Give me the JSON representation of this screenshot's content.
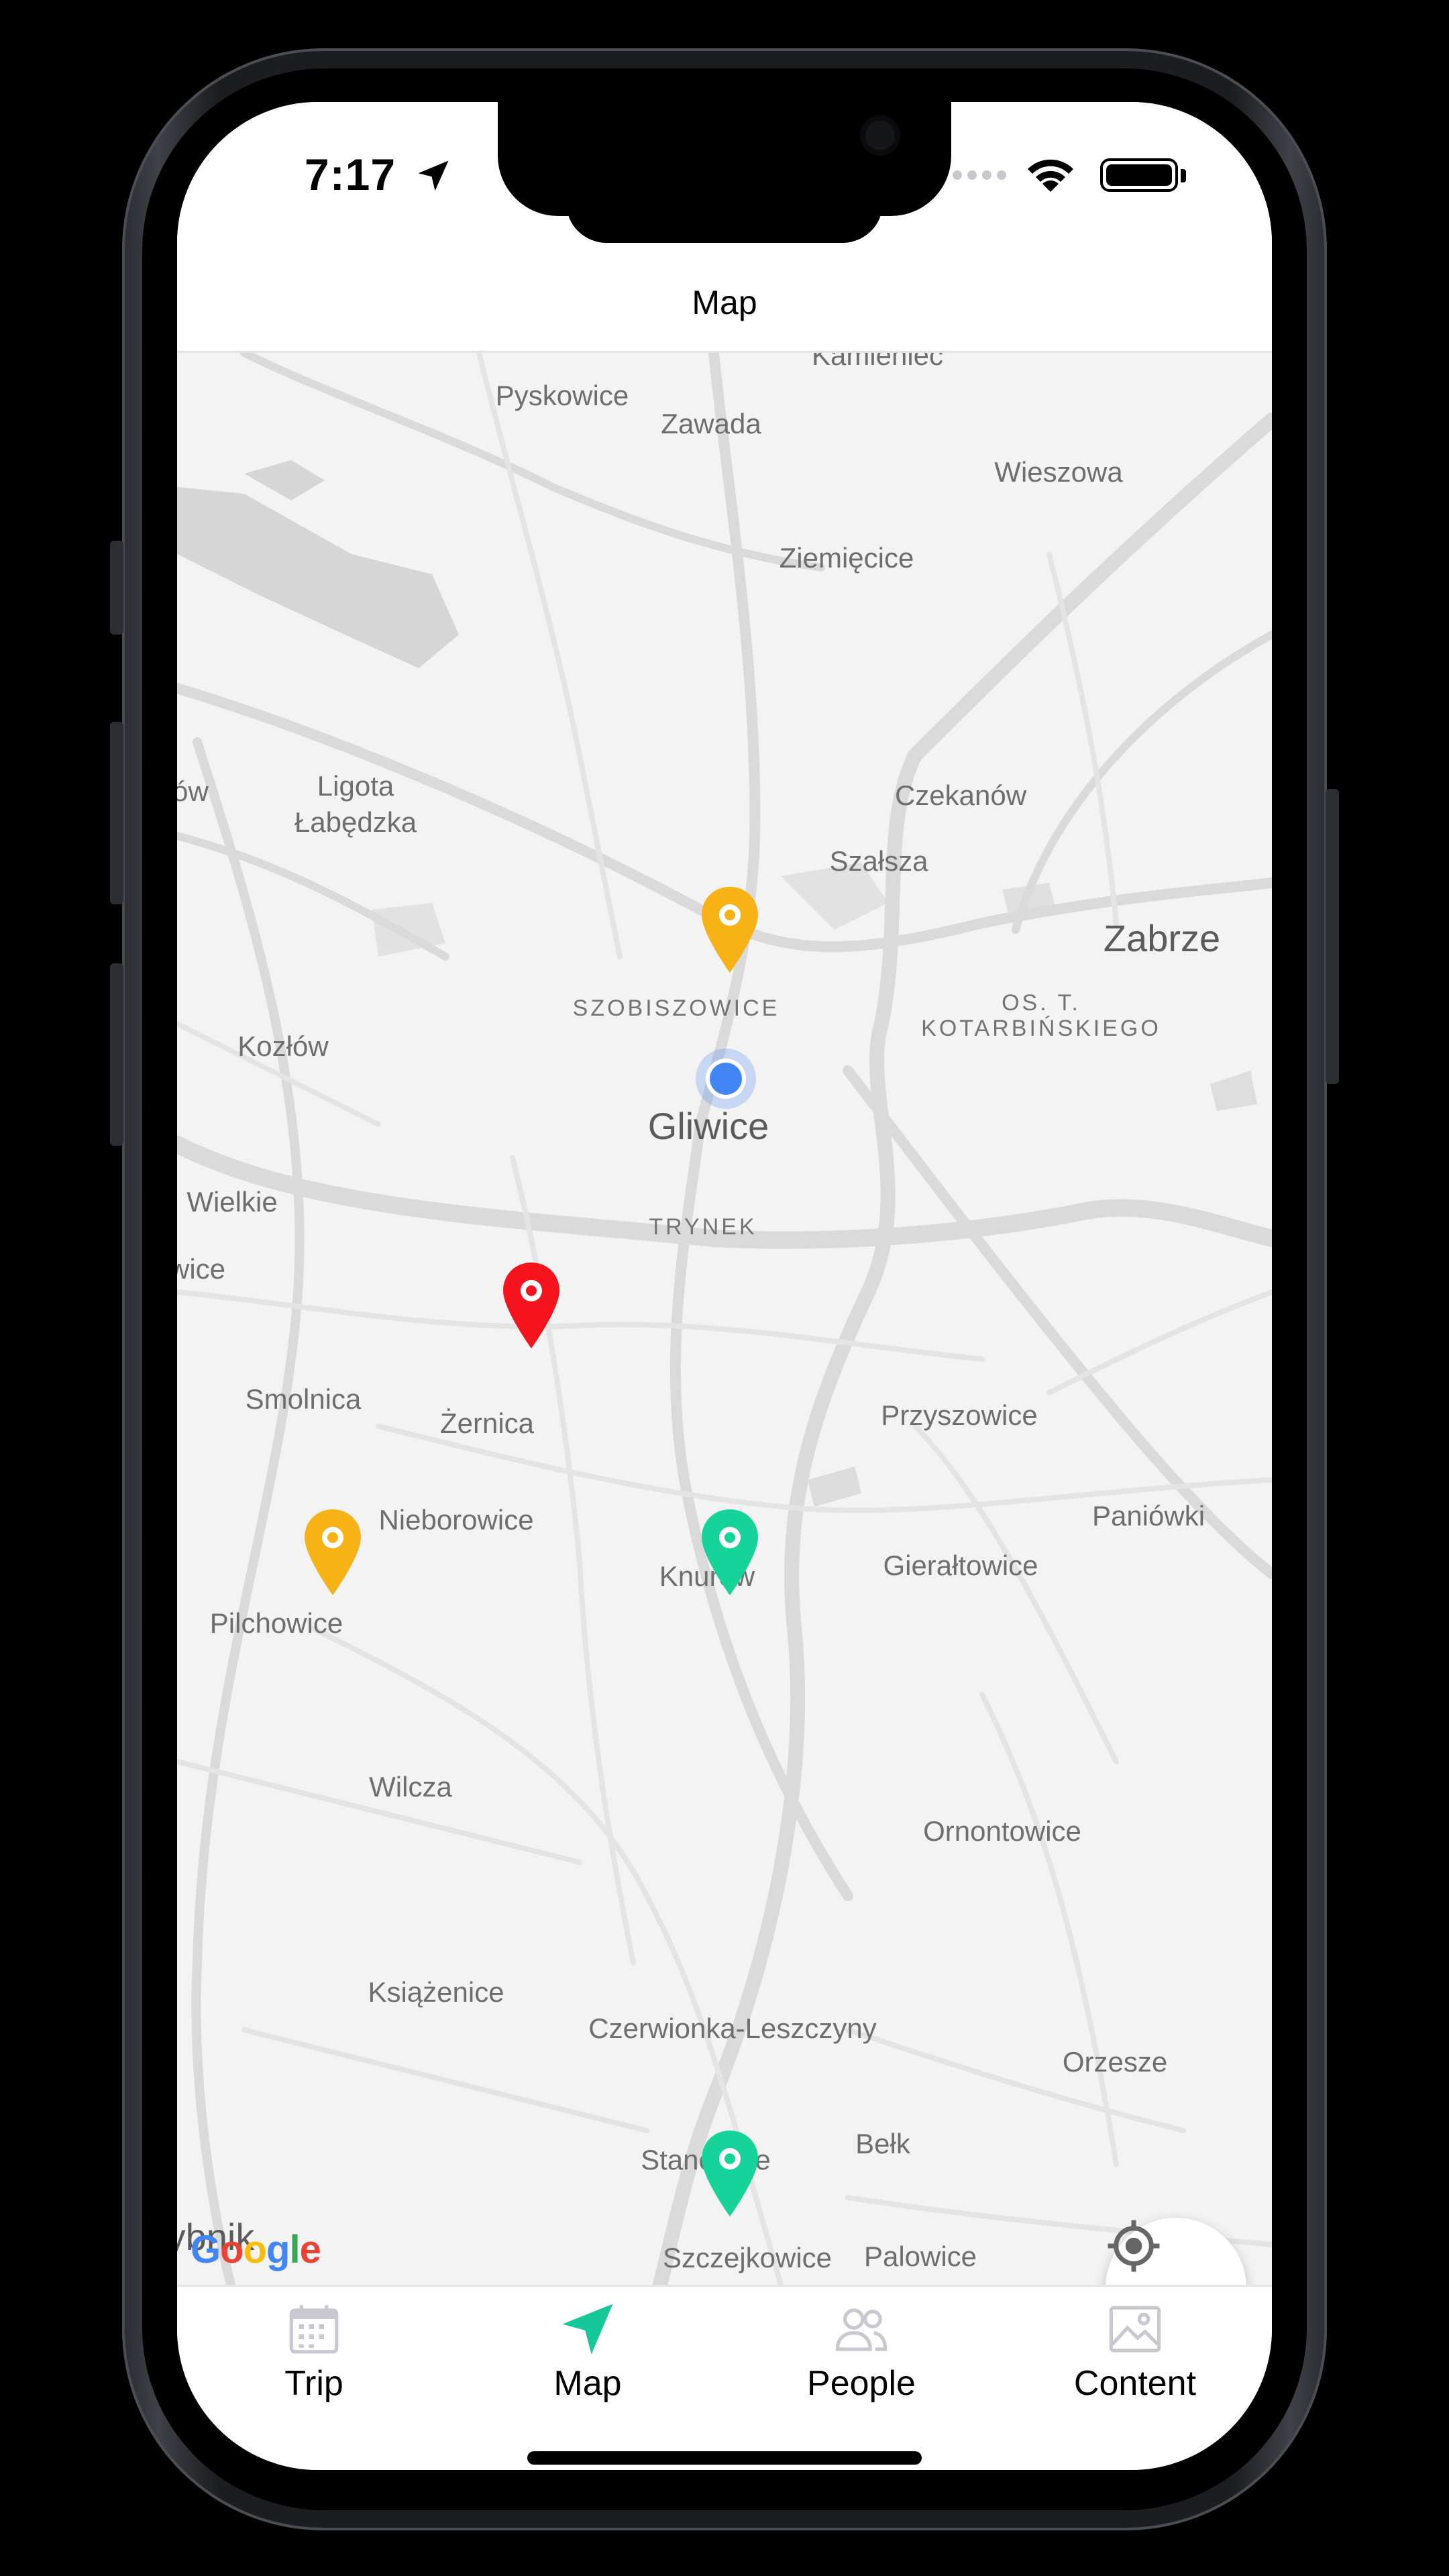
{
  "status_bar": {
    "time": "7:17"
  },
  "header": {
    "title": "Map"
  },
  "map": {
    "places": [
      {
        "id": "kamieniec",
        "name": "Kamieniec"
      },
      {
        "id": "pyskowice",
        "name": "Pyskowice"
      },
      {
        "id": "zawada",
        "name": "Zawada"
      },
      {
        "id": "wieszowa",
        "name": "Wieszowa"
      },
      {
        "id": "ziemiecice",
        "name": "Ziemięcice"
      },
      {
        "id": "ow",
        "name": "ów"
      },
      {
        "id": "ligota",
        "name": "Ligota"
      },
      {
        "id": "labedzka",
        "name": "Łabędzka"
      },
      {
        "id": "czekanow",
        "name": "Czekanów"
      },
      {
        "id": "szalsza",
        "name": "Szałsza"
      },
      {
        "id": "zabrze",
        "name": "Zabrze"
      },
      {
        "id": "szobiszowice",
        "name": "SZOBISZOWICE"
      },
      {
        "id": "kotarbinskiego1",
        "name": "OS. T."
      },
      {
        "id": "kotarbinskiego2",
        "name": "KOTARBIŃSKIEGO"
      },
      {
        "id": "kozlow",
        "name": "Kozłów"
      },
      {
        "id": "gliwice",
        "name": "Gliwice"
      },
      {
        "id": "wielkie",
        "name": "Wielkie"
      },
      {
        "id": "trynek",
        "name": "TRYNEK"
      },
      {
        "id": "wice",
        "name": "wice"
      },
      {
        "id": "smolnica",
        "name": "Smolnica"
      },
      {
        "id": "zernica",
        "name": "Żernica"
      },
      {
        "id": "przyszowice",
        "name": "Przyszowice"
      },
      {
        "id": "paniowki",
        "name": "Paniówki"
      },
      {
        "id": "nieborowice",
        "name": "Nieborowice"
      },
      {
        "id": "knurow",
        "name": "Knurów"
      },
      {
        "id": "gieraltowice",
        "name": "Gierałtowice"
      },
      {
        "id": "pilchowice",
        "name": "Pilchowice"
      },
      {
        "id": "wilcza",
        "name": "Wilcza"
      },
      {
        "id": "ornontowice",
        "name": "Ornontowice"
      },
      {
        "id": "ksiazenice",
        "name": "Książenice"
      },
      {
        "id": "czerwionka",
        "name": "Czerwionka-Leszczyny"
      },
      {
        "id": "orzesze",
        "name": "Orzesze"
      },
      {
        "id": "stanowice",
        "name": "Stanowice"
      },
      {
        "id": "belk",
        "name": "Bełk"
      },
      {
        "id": "rybnik",
        "name": "ybnik"
      },
      {
        "id": "szczejkowice",
        "name": "Szczejkowice"
      },
      {
        "id": "palowice",
        "name": "Palowice"
      }
    ],
    "pins": [
      {
        "id": "pin-yellow-1",
        "color": "#f7b316"
      },
      {
        "id": "pin-red",
        "color": "#f5141e"
      },
      {
        "id": "pin-yellow-2",
        "color": "#f7b316"
      },
      {
        "id": "pin-green-1",
        "color": "#16d39a"
      },
      {
        "id": "pin-green-2",
        "color": "#16d39a"
      }
    ],
    "user_location_color": "#4285f4",
    "attribution": [
      "G",
      "o",
      "o",
      "g",
      "l",
      "e"
    ]
  },
  "tabs": [
    {
      "id": "trip",
      "label": "Trip",
      "icon": "calendar-icon",
      "active": false
    },
    {
      "id": "map",
      "label": "Map",
      "icon": "navigation-arrow-icon",
      "active": true
    },
    {
      "id": "people",
      "label": "People",
      "icon": "people-icon",
      "active": false
    },
    {
      "id": "content",
      "label": "Content",
      "icon": "image-icon",
      "active": false
    }
  ],
  "colors": {
    "accent": "#16c79a",
    "inactive_icon": "#c8c8d0"
  }
}
